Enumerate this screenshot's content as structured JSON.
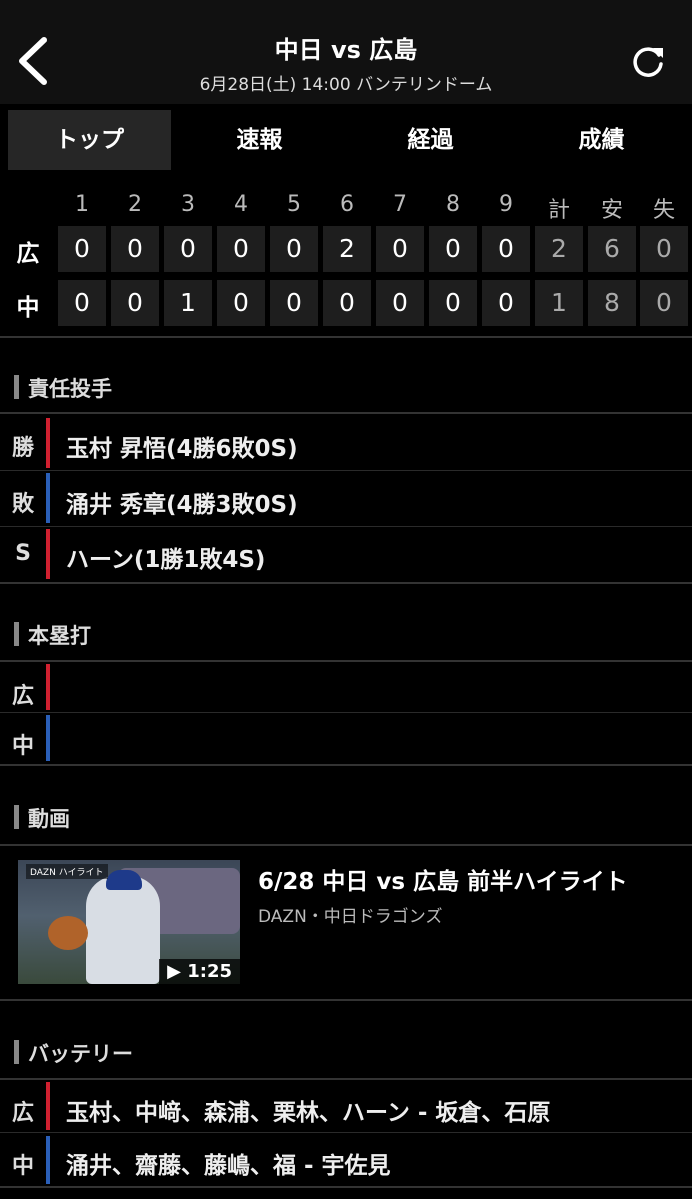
{
  "header": {
    "title": "中日 vs 広島",
    "subtitle": "6月28日(土) 14:00 バンテリンドーム"
  },
  "tabs": [
    {
      "label": "トップ",
      "active": true
    },
    {
      "label": "速報",
      "active": false
    },
    {
      "label": "経過",
      "active": false
    },
    {
      "label": "成績",
      "active": false
    }
  ],
  "scoreboard": {
    "columns": [
      "1",
      "2",
      "3",
      "4",
      "5",
      "6",
      "7",
      "8",
      "9",
      "計",
      "安",
      "失"
    ],
    "rows": [
      {
        "team": "広",
        "values": [
          "0",
          "0",
          "0",
          "0",
          "0",
          "2",
          "0",
          "0",
          "0",
          "2",
          "6",
          "0"
        ]
      },
      {
        "team": "中",
        "values": [
          "0",
          "0",
          "1",
          "0",
          "0",
          "0",
          "0",
          "0",
          "0",
          "1",
          "8",
          "0"
        ]
      }
    ]
  },
  "pitchers": {
    "title": "責任投手",
    "rows": [
      {
        "label": "勝",
        "text": "玉村 昇悟(4勝6敗0S)",
        "color": "#d02030"
      },
      {
        "label": "敗",
        "text": "涌井 秀章(4勝3敗0S)",
        "color": "#2a5fb8"
      },
      {
        "label": "S",
        "text": "ハーン(1勝1敗4S)",
        "color": "#d02030"
      }
    ]
  },
  "homeruns": {
    "title": "本塁打",
    "rows": [
      {
        "label": "広",
        "text": ""
      },
      {
        "label": "中",
        "text": ""
      }
    ]
  },
  "video": {
    "title": "動画",
    "item_title": "6/28 中日 vs 広島 前半ハイライト",
    "source": "DAZN・中日ドラゴンズ",
    "duration": "▶ 1:25",
    "thumb_logo": "DAZN ハイライト"
  },
  "battery": {
    "title": "バッテリー",
    "rows": [
      {
        "label": "広",
        "text": "玉村、中﨑、森浦、栗林、ハーン - 坂倉、石原"
      },
      {
        "label": "中",
        "text": "涌井、齋藤、藤嶋、福 - 宇佐見"
      }
    ]
  }
}
